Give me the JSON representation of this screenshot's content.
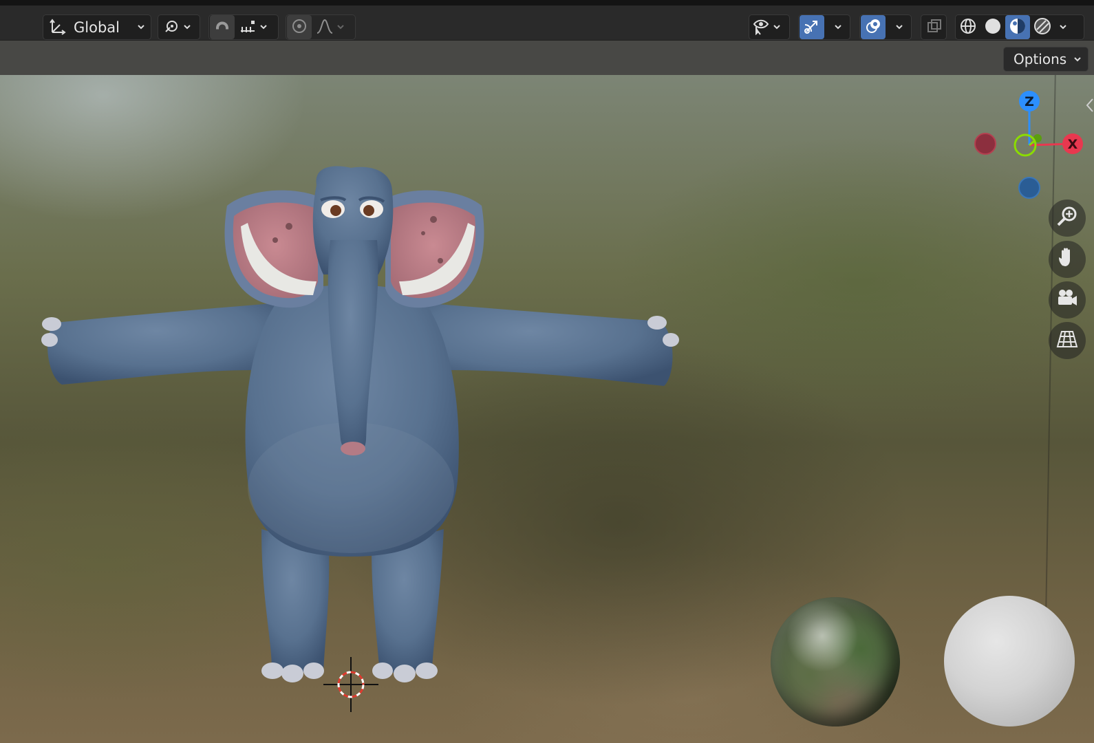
{
  "header": {
    "transform_orientation": {
      "label": "Global",
      "icon": "orientation-axes-icon"
    },
    "pivot_icon": "pivot-point-icon",
    "snap_icon": "snap-magnet-icon",
    "snap_target_icon": "snap-increment-icon",
    "proportional_icon": "proportional-edit-icon",
    "falloff_icon": "falloff-curve-icon",
    "visibility_icon": "eye-selectability-icon",
    "gizmo_icon": "gizmo-toggle-icon",
    "overlay_icon": "overlays-icon",
    "xray_icon": "xray-toggle-icon",
    "shading_modes": [
      "wireframe-icon",
      "solid-icon",
      "material-preview-icon",
      "rendered-icon"
    ],
    "active_shading": "material-preview-icon"
  },
  "toolbar": {
    "options_label": "Options"
  },
  "gizmo": {
    "z_label": "Z",
    "x_label": "X",
    "colors": {
      "x": "#e8384f",
      "y": "#8bdc00",
      "z": "#2c8fff",
      "neg_x": "#8c2f3e",
      "neg_z": "#2a5d95"
    }
  },
  "nav_buttons": [
    "zoom-icon",
    "hand-pan-icon",
    "camera-view-icon",
    "perspective-grid-icon"
  ],
  "accent": "#4772b3"
}
